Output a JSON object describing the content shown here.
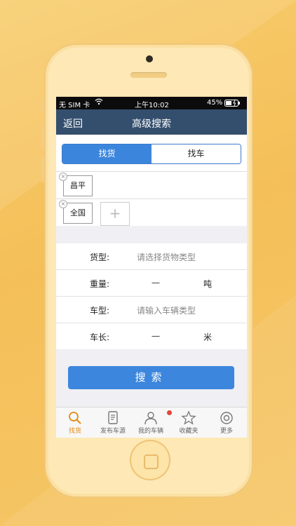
{
  "status_bar": {
    "carrier": "无 SIM 卡",
    "time": "上午10:02",
    "battery": "45%"
  },
  "nav": {
    "back_label": "返回",
    "title": "高级搜索"
  },
  "segments": {
    "active": "找货",
    "inactive": "找车"
  },
  "tags": [
    {
      "label": "昌平"
    },
    {
      "label": "全国"
    }
  ],
  "add_label": "+",
  "form": {
    "cargo_type": {
      "label": "货型:",
      "placeholder": "请选择货物类型"
    },
    "weight": {
      "label": "重量:",
      "separator": "一",
      "unit": "吨"
    },
    "vehicle_type": {
      "label": "车型:",
      "placeholder": "请输入车辆类型"
    },
    "vehicle_length": {
      "label": "车长:",
      "separator": "一",
      "unit": "米"
    }
  },
  "search_button": "搜索",
  "tabbar": {
    "items": [
      {
        "label": "找货",
        "icon": "search-icon",
        "active": true
      },
      {
        "label": "发布车源",
        "icon": "document-icon",
        "active": false
      },
      {
        "label": "我的车辆",
        "icon": "user-icon",
        "active": false,
        "badge": true
      },
      {
        "label": "收藏夹",
        "icon": "star-icon",
        "active": false
      },
      {
        "label": "更多",
        "icon": "more-icon",
        "active": false
      }
    ]
  },
  "colors": {
    "accent": "#3b86dc",
    "nav_bg": "#344f6e",
    "active_tab": "#e38a12",
    "badge": "#e2453a",
    "background": "#f5c35f"
  }
}
